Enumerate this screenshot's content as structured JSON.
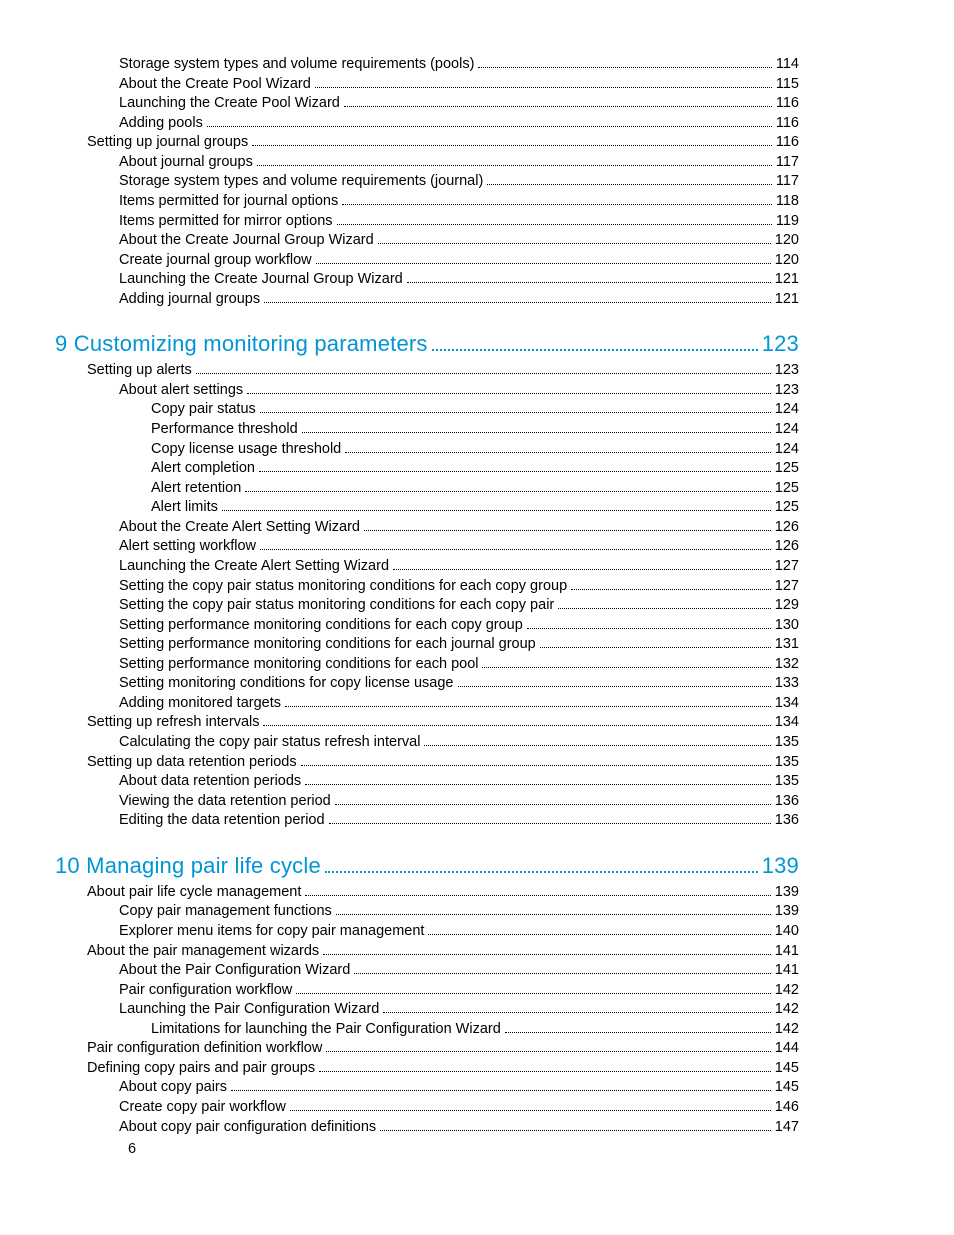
{
  "page_number": "6",
  "sections": [
    {
      "entries": [
        {
          "level": 2,
          "title": "Storage system types and volume requirements (pools)",
          "page": "114"
        },
        {
          "level": 2,
          "title": "About the Create Pool Wizard",
          "page": "115"
        },
        {
          "level": 2,
          "title": "Launching the Create Pool Wizard",
          "page": "116"
        },
        {
          "level": 2,
          "title": "Adding pools",
          "page": "116"
        },
        {
          "level": 1,
          "title": "Setting up journal groups",
          "page": "116"
        },
        {
          "level": 2,
          "title": "About journal groups",
          "page": "117"
        },
        {
          "level": 2,
          "title": "Storage system types and volume requirements (journal)",
          "page": "117"
        },
        {
          "level": 2,
          "title": "Items permitted for journal options",
          "page": "118"
        },
        {
          "level": 2,
          "title": "Items permitted for mirror options",
          "page": "119"
        },
        {
          "level": 2,
          "title": "About the Create Journal Group Wizard",
          "page": "120"
        },
        {
          "level": 2,
          "title": "Create journal group workflow",
          "page": "120"
        },
        {
          "level": 2,
          "title": "Launching the Create Journal Group Wizard",
          "page": "121"
        },
        {
          "level": 2,
          "title": "Adding journal groups",
          "page": "121"
        }
      ]
    },
    {
      "chapter": {
        "title": "9 Customizing monitoring parameters",
        "page": "123"
      },
      "entries": [
        {
          "level": 1,
          "title": "Setting up alerts",
          "page": "123"
        },
        {
          "level": 2,
          "title": "About alert settings",
          "page": "123"
        },
        {
          "level": 3,
          "title": "Copy pair status",
          "page": "124"
        },
        {
          "level": 3,
          "title": "Performance threshold",
          "page": "124"
        },
        {
          "level": 3,
          "title": "Copy license usage threshold",
          "page": "124"
        },
        {
          "level": 3,
          "title": "Alert completion",
          "page": "125"
        },
        {
          "level": 3,
          "title": "Alert retention",
          "page": "125"
        },
        {
          "level": 3,
          "title": "Alert limits",
          "page": "125"
        },
        {
          "level": 2,
          "title": "About the Create Alert Setting Wizard",
          "page": "126"
        },
        {
          "level": 2,
          "title": "Alert setting workflow ",
          "page": "126"
        },
        {
          "level": 2,
          "title": "Launching the Create Alert Setting Wizard",
          "page": "127"
        },
        {
          "level": 2,
          "title": "Setting the copy pair status monitoring conditions for each copy group",
          "page": "127"
        },
        {
          "level": 2,
          "title": "Setting the copy pair status monitoring conditions for each copy pair",
          "page": "129"
        },
        {
          "level": 2,
          "title": "Setting performance monitoring conditions for each copy group",
          "page": "130"
        },
        {
          "level": 2,
          "title": "Setting performance monitoring conditions for each journal group",
          "page": "131"
        },
        {
          "level": 2,
          "title": "Setting performance monitoring conditions for each pool",
          "page": "132"
        },
        {
          "level": 2,
          "title": "Setting monitoring conditions for copy license usage",
          "page": "133"
        },
        {
          "level": 2,
          "title": "Adding monitored targets",
          "page": "134"
        },
        {
          "level": 1,
          "title": "Setting up refresh intervals",
          "page": "134"
        },
        {
          "level": 2,
          "title": "Calculating the copy pair status refresh interval",
          "page": "135"
        },
        {
          "level": 1,
          "title": "Setting up data retention periods",
          "page": "135"
        },
        {
          "level": 2,
          "title": "About data retention periods",
          "page": "135"
        },
        {
          "level": 2,
          "title": "Viewing the data retention period",
          "page": "136"
        },
        {
          "level": 2,
          "title": "Editing the data retention period",
          "page": "136"
        }
      ]
    },
    {
      "chapter": {
        "title": "10 Managing pair life cycle",
        "page": "139"
      },
      "entries": [
        {
          "level": 1,
          "title": "About pair life cycle management",
          "page": "139"
        },
        {
          "level": 2,
          "title": "Copy pair management functions",
          "page": "139"
        },
        {
          "level": 2,
          "title": "Explorer menu items for copy pair management ",
          "page": "140"
        },
        {
          "level": 1,
          "title": "About the pair management wizards",
          "page": "141"
        },
        {
          "level": 2,
          "title": "About the Pair Configuration Wizard",
          "page": "141"
        },
        {
          "level": 2,
          "title": "Pair configuration workflow",
          "page": "142"
        },
        {
          "level": 2,
          "title": "Launching the Pair Configuration Wizard",
          "page": "142"
        },
        {
          "level": 3,
          "title": "Limitations for launching the Pair Configuration Wizard",
          "page": "142"
        },
        {
          "level": 1,
          "title": "Pair configuration definition workflow",
          "page": "144"
        },
        {
          "level": 1,
          "title": "Defining copy pairs and pair groups",
          "page": "145"
        },
        {
          "level": 2,
          "title": "About copy pairs",
          "page": "145"
        },
        {
          "level": 2,
          "title": "Create copy pair workflow",
          "page": "146"
        },
        {
          "level": 2,
          "title": "About copy pair configuration definitions",
          "page": "147"
        }
      ]
    }
  ]
}
